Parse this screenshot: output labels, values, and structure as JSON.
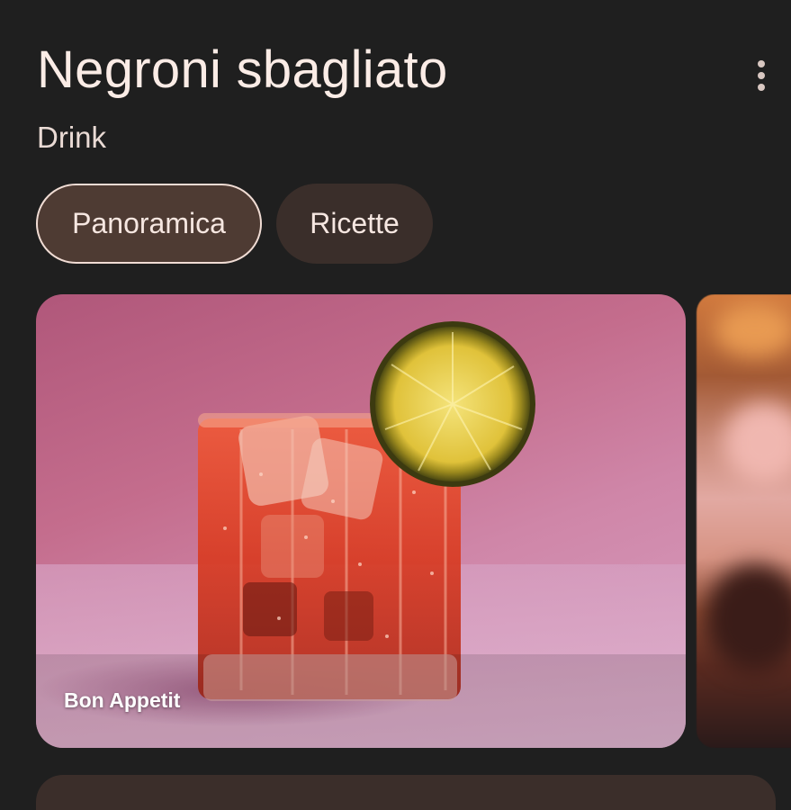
{
  "header": {
    "title": "Negroni sbagliato",
    "subtitle": "Drink",
    "more_icon": "more-vert-icon"
  },
  "tabs": [
    {
      "label": "Panoramica",
      "selected": true
    },
    {
      "label": "Ricette",
      "selected": false
    }
  ],
  "carousel": {
    "items": [
      {
        "source": "Bon Appetit",
        "image": "negroni-sbagliato-cocktail-photo"
      },
      {
        "source": "",
        "image": "blurred-bar-photo"
      }
    ]
  },
  "colors": {
    "background": "#1f1f1f",
    "chip_selected": "#4e3b33",
    "chip_default": "#3a2e2a",
    "text_primary": "#fbece6"
  }
}
